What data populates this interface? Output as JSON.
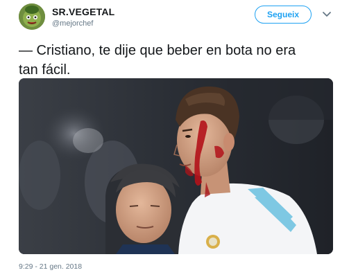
{
  "author": {
    "display_name": "SR.VEGETAL",
    "handle": "@mejorchef",
    "avatar_icon": "vegetable-avatar-icon"
  },
  "follow_button": {
    "label": "Segueix"
  },
  "menu_icon": "chevron-down-icon",
  "tweet": {
    "text_line_1": "— Cristiano, te dije que beber en bota no era",
    "text_line_2": "tan fácil."
  },
  "timestamp": "9:29 - 21 gen. 2018",
  "colors": {
    "accent": "#1da1f2",
    "text": "#14171a",
    "muted": "#657786"
  }
}
